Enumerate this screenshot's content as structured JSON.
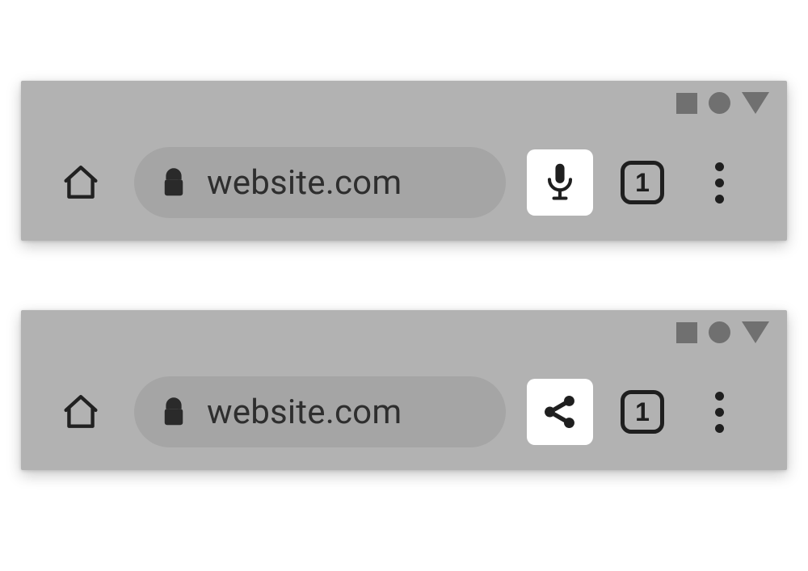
{
  "variants": [
    {
      "id": "a",
      "url": "website.com",
      "tab_count": "1",
      "action_icon": "microphone"
    },
    {
      "id": "b",
      "url": "website.com",
      "tab_count": "1",
      "action_icon": "share"
    }
  ],
  "icons": {
    "home": "home-icon",
    "lock": "lock-icon",
    "microphone": "microphone-icon",
    "share": "share-icon",
    "more": "more-vert-icon",
    "status_square": "status-square-icon",
    "status_circle": "status-circle-icon",
    "status_triangle": "status-triangle-icon"
  }
}
